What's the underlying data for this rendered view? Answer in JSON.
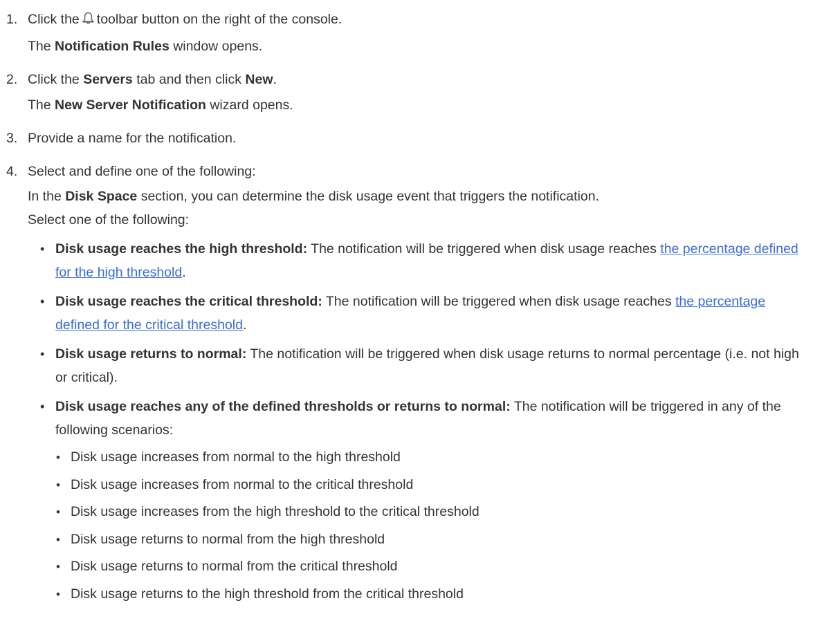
{
  "steps": [
    {
      "number": "1.",
      "line1": {
        "pre": "Click the",
        "icon": "bell-icon",
        "post": "toolbar button on the right of the console."
      },
      "line2": {
        "pre": "The ",
        "bold": "Notification Rules",
        "post": " window opens."
      }
    },
    {
      "number": "2.",
      "line1": {
        "pre": "Click the ",
        "bold1": "Servers",
        "mid": " tab and then click ",
        "bold2": "New",
        "post": "."
      },
      "line2": {
        "pre": "The ",
        "bold": "New Server Notification",
        "post": " wizard opens."
      }
    },
    {
      "number": "3.",
      "text": "Provide a name for the notification."
    },
    {
      "number": "4.",
      "line1": "Select and define one of the following:",
      "line2": {
        "pre": "In the ",
        "bold": "Disk Space",
        "post": " section, you can determine the disk usage event that triggers the notification."
      },
      "line3": "Select one of the following:",
      "options": [
        {
          "label": "Disk usage reaches the high threshold:",
          "text": " The notification will be triggered when disk usage reaches ",
          "link": "the percentage defined for the high threshold",
          "after": "."
        },
        {
          "label": "Disk usage reaches the critical threshold:",
          "text": " The notification will be triggered when disk usage reaches ",
          "link": "the percentage defined for the critical threshold",
          "after": "."
        },
        {
          "label": "Disk usage returns to normal:",
          "text": " The notification will be triggered when disk usage returns to normal percentage (i.e. not high or critical)."
        },
        {
          "label": "Disk usage reaches any of the defined thresholds or returns to normal:",
          "text": " The notification will be triggered in any of the following scenarios:",
          "scenarios": [
            "Disk usage increases from normal to the high threshold",
            "Disk usage increases from normal to the critical threshold",
            "Disk usage increases from the high threshold to the critical threshold",
            "Disk usage returns to normal from the high threshold",
            "Disk usage returns to normal from the critical threshold",
            "Disk usage returns to the high threshold from the critical threshold"
          ]
        }
      ]
    }
  ],
  "colors": {
    "text": "#333333",
    "link": "#3a6bd5",
    "background": "#ffffff"
  }
}
